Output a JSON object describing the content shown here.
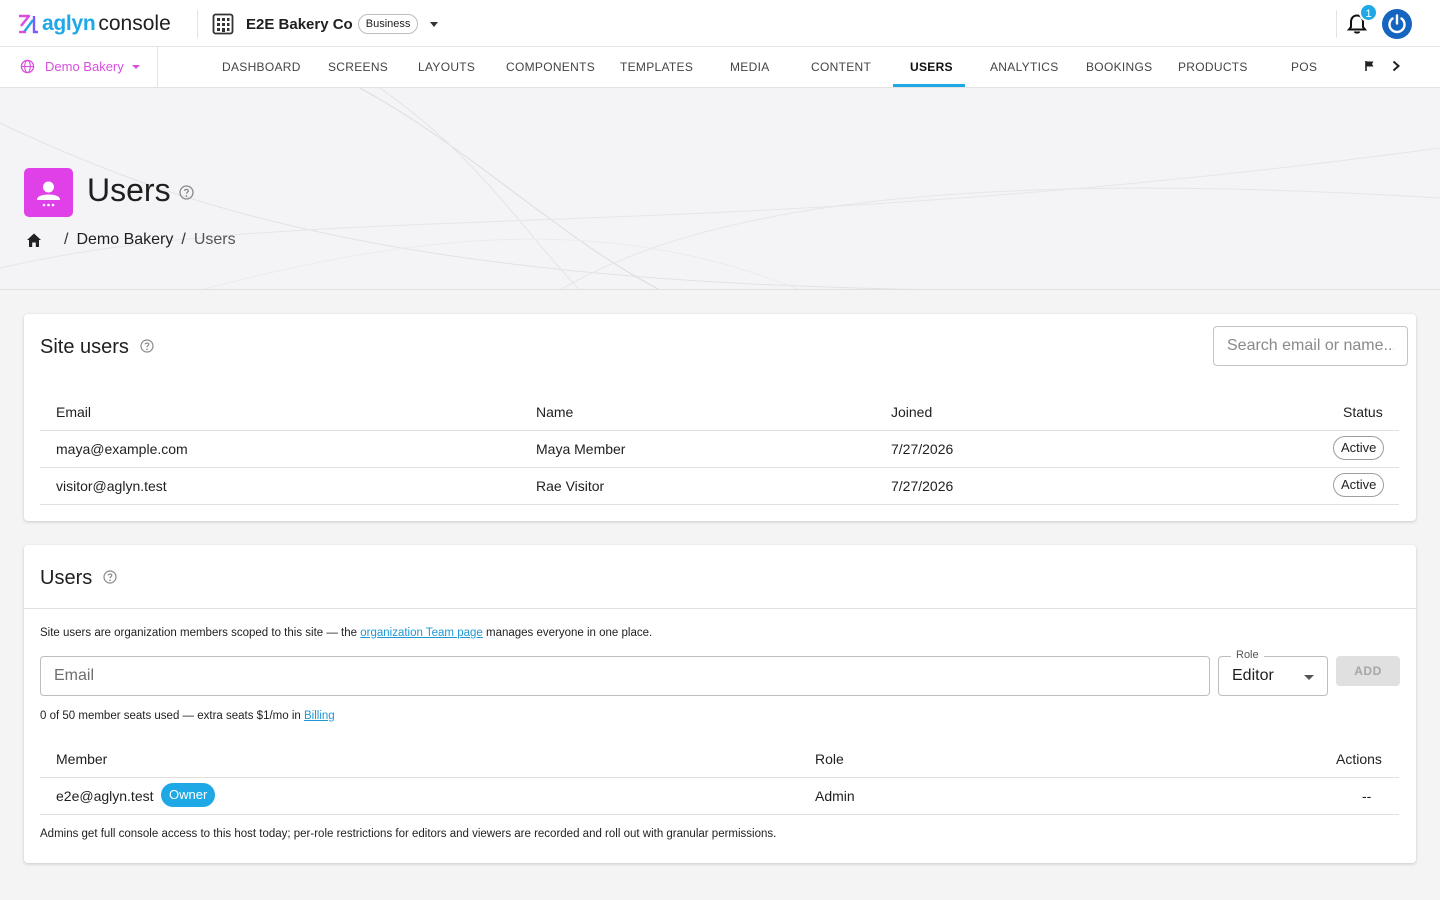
{
  "app": {
    "brand": "aglyn",
    "product": "console"
  },
  "org": {
    "name": "E2E Bakery Co",
    "plan": "Business"
  },
  "notifications": {
    "count": "1"
  },
  "site_selector": {
    "label": "Demo Bakery"
  },
  "nav": {
    "tabs": [
      "DASHBOARD",
      "SCREENS",
      "LAYOUTS",
      "COMPONENTS",
      "TEMPLATES",
      "MEDIA",
      "CONTENT",
      "USERS",
      "ANALYTICS",
      "BOOKINGS",
      "PRODUCTS",
      "POS"
    ],
    "active": "USERS"
  },
  "header": {
    "title": "Users",
    "breadcrumb": [
      "Demo Bakery",
      "Users"
    ]
  },
  "site_users": {
    "title": "Site users",
    "search_placeholder": "Search email or name...",
    "columns": [
      "Email",
      "Name",
      "Joined",
      "Status"
    ],
    "rows": [
      {
        "email": "maya@example.com",
        "name": "Maya Member",
        "joined": "7/27/2026",
        "status": "Active"
      },
      {
        "email": "visitor@aglyn.test",
        "name": "Rae Visitor",
        "joined": "7/27/2026",
        "status": "Active"
      }
    ]
  },
  "members": {
    "title": "Users",
    "info_prefix": "Site users are organization members scoped to this site — the ",
    "info_link": "organization Team page",
    "info_suffix": " manages everyone in one place.",
    "email_placeholder": "Email",
    "role_label": "Role",
    "role_value": "Editor",
    "add_label": "ADD",
    "seats_prefix": "0 of 50 member seats used — extra seats $1/mo in ",
    "seats_link": "Billing",
    "columns": [
      "Member",
      "Role",
      "Actions"
    ],
    "rows": [
      {
        "member": "e2e@aglyn.test",
        "badge": "Owner",
        "role": "Admin",
        "actions": "--"
      }
    ],
    "footnote": "Admins get full console access to this host today; per-role restrictions for editors and viewers are recorded and roll out with granular permissions."
  },
  "colors": {
    "accent": "#1fa8e6",
    "brand_magenta": "#e040e8",
    "power_blue": "#1565c0"
  },
  "icons": [
    "logo-mark-icon",
    "building-icon",
    "bell-icon",
    "power-icon",
    "globe-icon",
    "flag-icon",
    "chevron-right-icon",
    "user-badge-icon",
    "help-icon",
    "home-icon"
  ]
}
